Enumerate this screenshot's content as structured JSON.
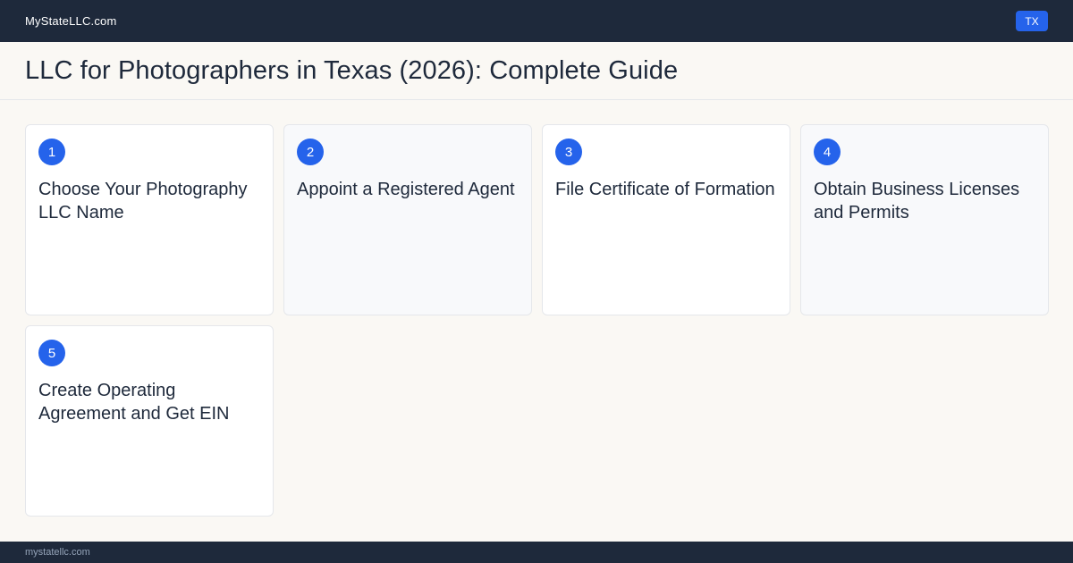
{
  "topbar": {
    "brand": "MyStateLLC.com",
    "state_badge": "TX"
  },
  "header": {
    "title": "LLC for Photographers in Texas (2026): Complete Guide"
  },
  "steps": [
    {
      "number": "1",
      "title": "Choose Your Photography LLC Name"
    },
    {
      "number": "2",
      "title": "Appoint a Registered Agent"
    },
    {
      "number": "3",
      "title": "File Certificate of Formation"
    },
    {
      "number": "4",
      "title": "Obtain Business Licenses and Permits"
    },
    {
      "number": "5",
      "title": "Create Operating Agreement and Get EIN"
    }
  ],
  "footer": {
    "url": "mystatellc.com"
  },
  "colors": {
    "navy": "#1e293b",
    "accent_blue": "#2563eb",
    "page_background": "#faf8f4"
  }
}
